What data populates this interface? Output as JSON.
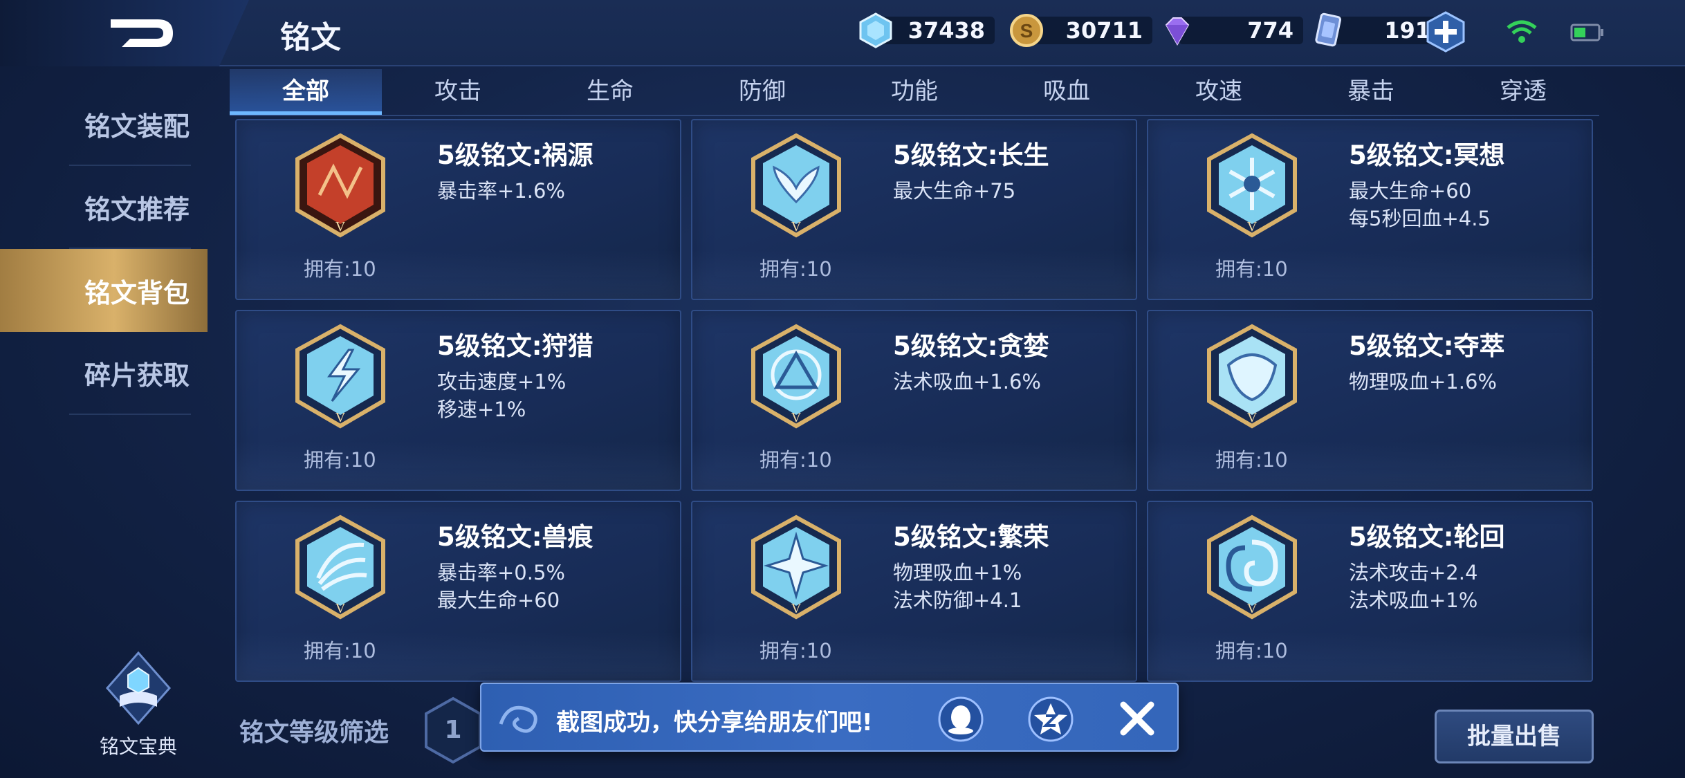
{
  "header": {
    "title": "铭文",
    "currencies": [
      {
        "icon": "crystal-icon",
        "value": "37438"
      },
      {
        "icon": "gold-coin-icon",
        "value": "30711"
      },
      {
        "icon": "diamond-icon",
        "value": "774"
      },
      {
        "icon": "rune-card-icon",
        "value": "191"
      }
    ]
  },
  "tabs": [
    "全部",
    "攻击",
    "生命",
    "防御",
    "功能",
    "吸血",
    "攻速",
    "暴击",
    "穿透"
  ],
  "sidebar": {
    "items": [
      "铭文装配",
      "铭文推荐",
      "铭文背包",
      "碎片获取"
    ],
    "active_index": 2,
    "codex_label": "铭文宝典"
  },
  "runes": [
    {
      "name": "5级铭文:祸源",
      "stats": [
        "暴击率+1.6%"
      ],
      "owned": "拥有:10",
      "color": "red"
    },
    {
      "name": "5级铭文:长生",
      "stats": [
        "最大生命+75"
      ],
      "owned": "拥有:10",
      "color": "blue"
    },
    {
      "name": "5级铭文:冥想",
      "stats": [
        "最大生命+60",
        "每5秒回血+4.5"
      ],
      "owned": "拥有:10",
      "color": "blue"
    },
    {
      "name": "5级铭文:狩猎",
      "stats": [
        "攻击速度+1%",
        "移速+1%"
      ],
      "owned": "拥有:10",
      "color": "blue"
    },
    {
      "name": "5级铭文:贪婪",
      "stats": [
        "法术吸血+1.6%"
      ],
      "owned": "拥有:10",
      "color": "blue"
    },
    {
      "name": "5级铭文:夺萃",
      "stats": [
        "物理吸血+1.6%"
      ],
      "owned": "拥有:10",
      "color": "blue"
    },
    {
      "name": "5级铭文:兽痕",
      "stats": [
        "暴击率+0.5%",
        "最大生命+60"
      ],
      "owned": "拥有:10",
      "color": "blue"
    },
    {
      "name": "5级铭文:繁荣",
      "stats": [
        "物理吸血+1%",
        "法术防御+4.1"
      ],
      "owned": "拥有:10",
      "color": "blue"
    },
    {
      "name": "5级铭文:轮回",
      "stats": [
        "法术攻击+2.4",
        "法术吸血+1%"
      ],
      "owned": "拥有:10",
      "color": "blue"
    }
  ],
  "bottom": {
    "filter_label": "铭文等级筛选",
    "level_chip": "1",
    "batch_sell": "批量出售"
  },
  "toast": {
    "text": "截图成功，快分享给朋友们吧!",
    "share_targets": [
      "qq-icon",
      "qzone-icon"
    ]
  },
  "colors": {
    "accent_gold": "#d9b16a",
    "tab_active": "#6eb8ff",
    "rune_red": "#c4402a",
    "rune_blue": "#7fd0ee"
  }
}
